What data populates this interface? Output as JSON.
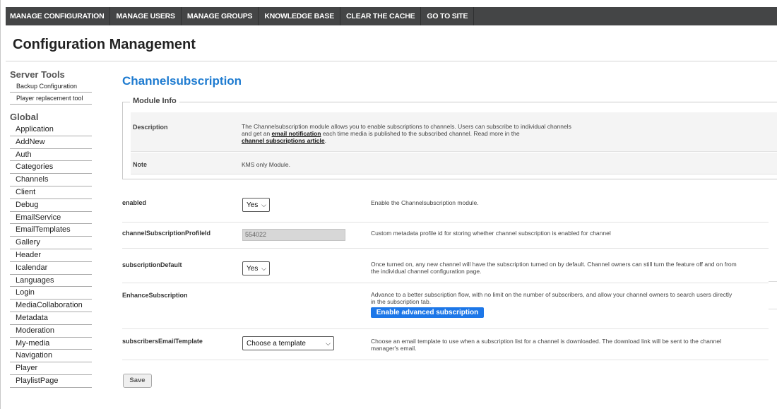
{
  "topnav": {
    "items": [
      "MANAGE CONFIGURATION",
      "MANAGE USERS",
      "MANAGE GROUPS",
      "KNOWLEDGE BASE",
      "CLEAR THE CACHE",
      "GO TO SITE"
    ]
  },
  "page": {
    "title": "Configuration Management"
  },
  "sidebar": {
    "server_tools_heading": "Server Tools",
    "server_tools": [
      "Backup Configuration",
      "Player replacement tool"
    ],
    "global_heading": "Global",
    "global_items": [
      "Application",
      "AddNew",
      "Auth",
      "Categories",
      "Channels",
      "Client",
      "Debug",
      "EmailService",
      "EmailTemplates",
      "Gallery",
      "Header",
      "Icalendar",
      "Languages",
      "Login",
      "MediaCollaboration",
      "Metadata",
      "Moderation",
      "My-media",
      "Navigation",
      "Player",
      "PlaylistPage"
    ]
  },
  "module": {
    "title": "Channelsubscription",
    "info_legend": "Module Info",
    "description_label": "Description",
    "description_text_1": "The Channelsubscription module allows you to enable subscriptions to channels. Users can subscribe to individual channels and get an ",
    "description_link_1": "email notification",
    "description_text_2": " each time media is published to the subscribed channel. Read more in the ",
    "description_link_2": "channel subscriptions article",
    "description_text_3": ".",
    "note_label": "Note",
    "note_text": "KMS only Module."
  },
  "settings": {
    "enabled": {
      "label": "enabled",
      "value": "Yes",
      "desc": "Enable the Channelsubscription module."
    },
    "profile": {
      "label": "channelSubscriptionProfileId",
      "value": "554022",
      "desc": "Custom metadata profile id for storing whether channel subscription is enabled for channel"
    },
    "default": {
      "label": "subscriptionDefault",
      "value": "Yes",
      "desc": "Once turned on, any new channel will have the subscription turned on by default. Channel owners can still turn the feature off and on from the individual channel configuration page."
    },
    "enhance": {
      "label": "EnhanceSubscription",
      "desc": "Advance to a better subscription flow, with no limit on the number of subscribers, and allow your channel owners to search users directly in the subscription tab.",
      "button": "Enable advanced subscription"
    },
    "template": {
      "label": "subscribersEmailTemplate",
      "value": "Choose a template",
      "desc": "Choose an email template to use when a subscription list for a channel is downloaded. The download link will be sent to the channel manager's email."
    }
  },
  "actions": {
    "save_label": "Save"
  },
  "colors": {
    "nav_bg": "#444546",
    "module_title": "#1e7bd0",
    "button_blue": "#1d77e8"
  },
  "icons": {
    "select_chevron": "chevron-down-icon"
  }
}
